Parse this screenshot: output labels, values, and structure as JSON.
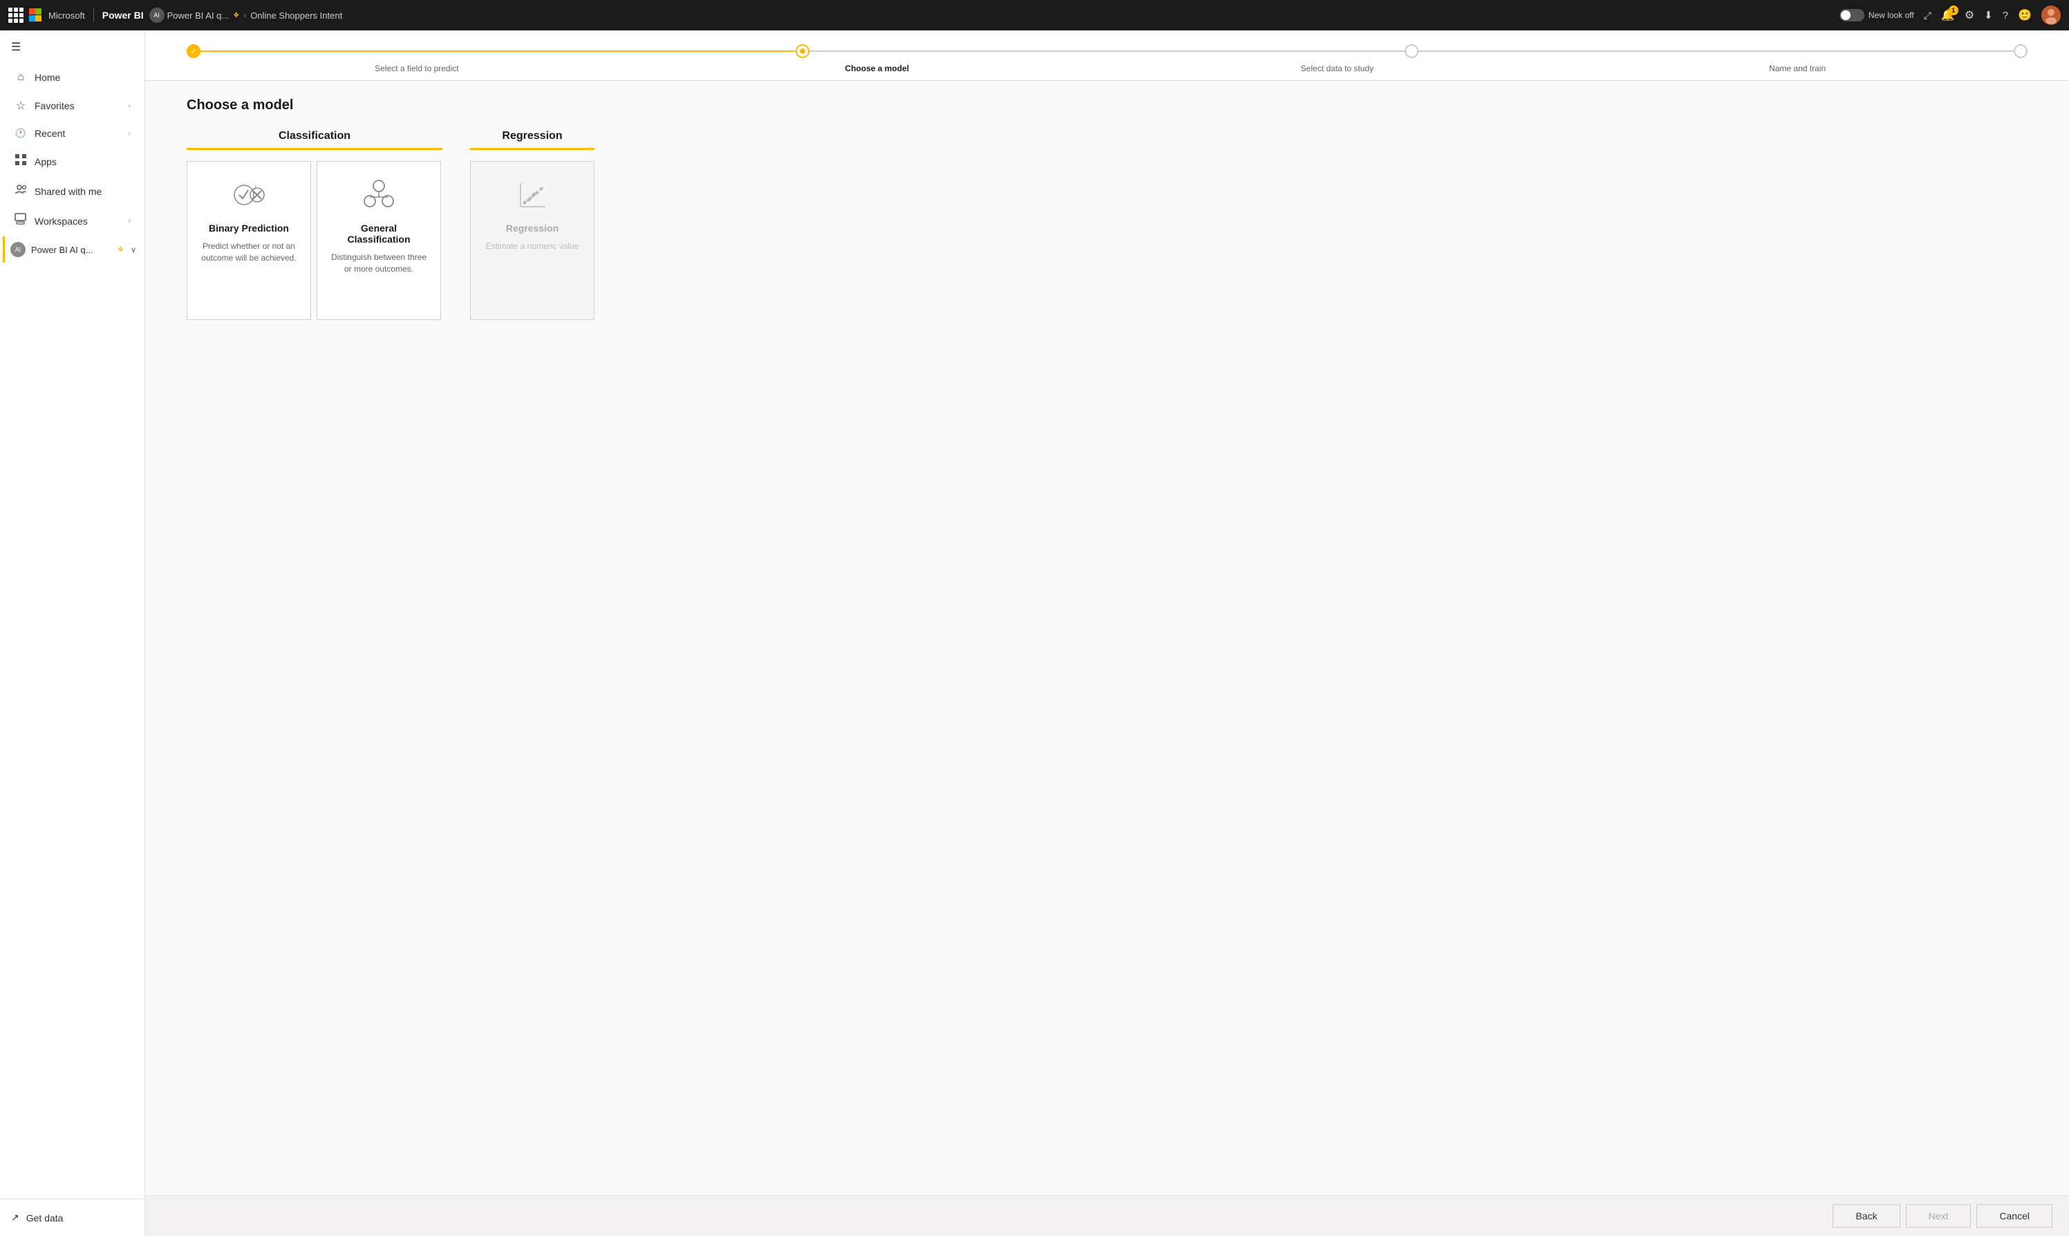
{
  "topnav": {
    "waffle_label": "Apps menu",
    "microsoft_label": "Microsoft",
    "powerbi_label": "Power BI",
    "workspace_name": "Power BI AI q...",
    "breadcrumb_sep1": "❖",
    "breadcrumb_arrow": ">",
    "breadcrumb_page": "Online Shoppers Intent",
    "new_look_label": "New look off",
    "notification_count": "1",
    "avatar_initials": "👤"
  },
  "sidebar": {
    "toggle_label": "☰",
    "items": [
      {
        "id": "home",
        "icon": "⌂",
        "label": "Home"
      },
      {
        "id": "favorites",
        "icon": "☆",
        "label": "Favorites",
        "has_chevron": true
      },
      {
        "id": "recent",
        "icon": "🕐",
        "label": "Recent",
        "has_chevron": true
      },
      {
        "id": "apps",
        "icon": "⊞",
        "label": "Apps"
      },
      {
        "id": "shared",
        "icon": "👤",
        "label": "Shared with me"
      },
      {
        "id": "workspaces",
        "icon": "🗂",
        "label": "Workspaces",
        "has_chevron": true
      }
    ],
    "workspace_item": {
      "label": "Power BI AI q...",
      "diamond": "❖",
      "chevron": "∨"
    },
    "bottom_items": [
      {
        "id": "get-data",
        "icon": "↗",
        "label": "Get data"
      }
    ]
  },
  "wizard": {
    "steps": [
      {
        "id": "select-field",
        "label": "Select a field to predict",
        "state": "completed"
      },
      {
        "id": "choose-model",
        "label": "Choose a model",
        "state": "active"
      },
      {
        "id": "select-data",
        "label": "Select data to study",
        "state": "inactive"
      },
      {
        "id": "name-train",
        "label": "Name and train",
        "state": "inactive"
      }
    ]
  },
  "page": {
    "title": "Choose a model",
    "categories": [
      {
        "id": "classification",
        "label": "Classification",
        "models": [
          {
            "id": "binary-prediction",
            "title": "Binary Prediction",
            "description": "Predict whether or not an outcome will be achieved.",
            "disabled": false
          },
          {
            "id": "general-classification",
            "title": "General Classification",
            "description": "Distinguish between three or more outcomes.",
            "disabled": false
          }
        ]
      },
      {
        "id": "regression",
        "label": "Regression",
        "models": [
          {
            "id": "regression-model",
            "title": "Regression",
            "description": "Estimate a numeric value",
            "disabled": true
          }
        ]
      }
    ]
  },
  "actions": {
    "back_label": "Back",
    "next_label": "Next",
    "cancel_label": "Cancel"
  }
}
